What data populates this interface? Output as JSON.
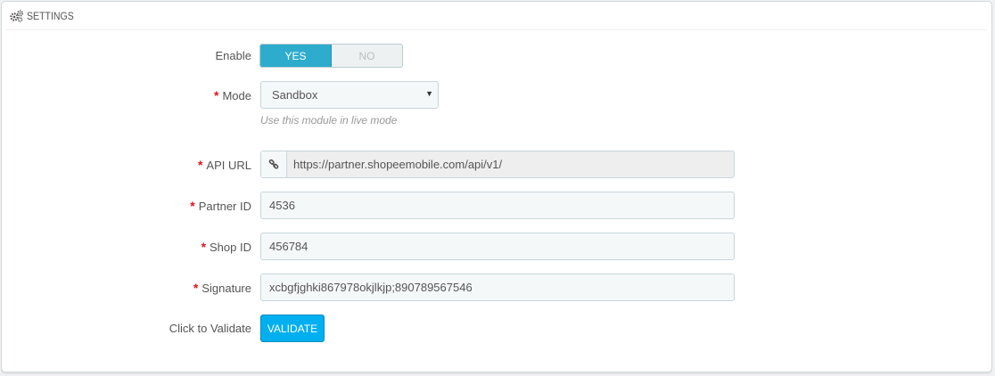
{
  "panel": {
    "title": "SETTINGS",
    "icon": "gears-icon"
  },
  "form": {
    "enable": {
      "label": "Enable",
      "yes": "YES",
      "no": "NO",
      "selected": "YES"
    },
    "mode": {
      "required_mark": "*",
      "label": "Mode",
      "value": "Sandbox",
      "help": "Use this module in live mode"
    },
    "api_url": {
      "required_mark": "*",
      "label": "API URL",
      "value": "https://partner.shopeemobile.com/api/v1/",
      "icon": "link-icon"
    },
    "partner_id": {
      "required_mark": "*",
      "label": "Partner ID",
      "value": "4536"
    },
    "shop_id": {
      "required_mark": "*",
      "label": "Shop ID",
      "value": "456784"
    },
    "signature": {
      "required_mark": "*",
      "label": "Signature",
      "value": "xcbgfjghki867978okjlkjp;890789567546"
    },
    "validate": {
      "label": "Click to Validate",
      "button": "VALIDATE"
    }
  },
  "colors": {
    "switch_on": "#2eacce",
    "validate_button": "#00aff0",
    "required": "#e3121f"
  }
}
